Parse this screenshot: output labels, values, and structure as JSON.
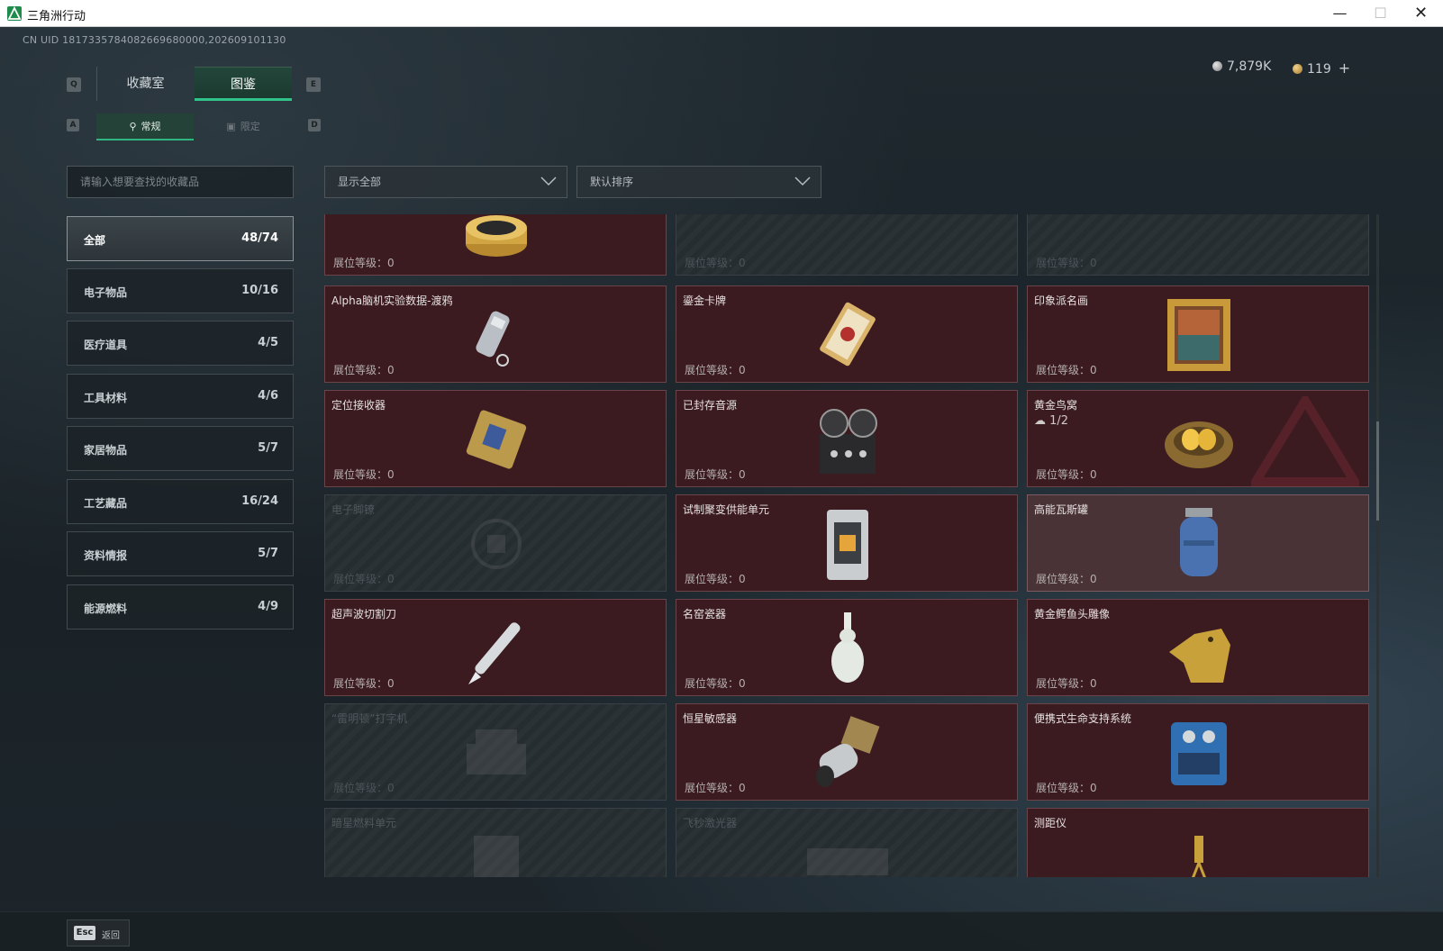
{
  "window": {
    "title": "三角洲行动",
    "controls": {
      "minimize": "—",
      "maximize": "☐",
      "close": "✕"
    }
  },
  "header": {
    "uid": "CN UID 1817335784082669680000,202609101130",
    "currency": [
      {
        "icon": "silver-coin-icon",
        "value": "7,879K"
      },
      {
        "icon": "gold-coin-icon",
        "value": "119",
        "add_label": "+"
      }
    ]
  },
  "tabs": {
    "key_left": "Q",
    "key_right": "E",
    "items": [
      {
        "label": "收藏室",
        "active": false
      },
      {
        "label": "图鉴",
        "active": true
      }
    ]
  },
  "subtabs": {
    "key_left": "A",
    "key_right": "D",
    "items": [
      {
        "icon": "pin-icon",
        "label": "常规",
        "active": true
      },
      {
        "icon": "image-icon",
        "label": "限定",
        "active": false
      }
    ]
  },
  "search": {
    "placeholder": "请输入想要查找的收藏品"
  },
  "filters": [
    {
      "value": "显示全部"
    },
    {
      "value": "默认排序"
    }
  ],
  "categories": [
    {
      "label": "全部",
      "count": "48/74",
      "active": true
    },
    {
      "label": "电子物品",
      "count": "10/16"
    },
    {
      "label": "医疗道具",
      "count": "4/5"
    },
    {
      "label": "工具材料",
      "count": "4/6"
    },
    {
      "label": "家居物品",
      "count": "5/7"
    },
    {
      "label": "工艺藏品",
      "count": "16/24"
    },
    {
      "label": "资料情报",
      "count": "5/7"
    },
    {
      "label": "能源燃料",
      "count": "4/9"
    }
  ],
  "items": [
    {
      "name": "",
      "level": "展位等级：0",
      "state": "owned",
      "icon": "caviar-tin-icon"
    },
    {
      "name": "",
      "level": "展位等级：0",
      "state": "locked",
      "icon": "unknown-item-icon"
    },
    {
      "name": "",
      "level": "展位等级：0",
      "state": "locked",
      "icon": "unknown-item-icon"
    },
    {
      "name": "Alpha脑机实验数据-渡鸦",
      "level": "展位等级：0",
      "state": "owned",
      "icon": "data-drive-icon"
    },
    {
      "name": "鎏金卡牌",
      "level": "展位等级：0",
      "state": "owned",
      "icon": "gilded-card-icon"
    },
    {
      "name": "印象派名画",
      "level": "展位等级：0",
      "state": "owned",
      "icon": "painting-icon"
    },
    {
      "name": "定位接收器",
      "level": "展位等级：0",
      "state": "owned",
      "icon": "receiver-icon"
    },
    {
      "name": "已封存音源",
      "level": "展位等级：0",
      "state": "owned",
      "icon": "reel-recorder-icon"
    },
    {
      "name": "黄金鸟窝",
      "level": "展位等级：0",
      "state": "owned",
      "icon": "golden-nest-icon",
      "extra": "1/2"
    },
    {
      "name": "电子脚镣",
      "level": "展位等级：0",
      "state": "locked",
      "icon": "ankle-monitor-icon"
    },
    {
      "name": "试制聚变供能单元",
      "level": "展位等级：0",
      "state": "owned",
      "icon": "fusion-unit-icon"
    },
    {
      "name": "高能瓦斯罐",
      "level": "展位等级：0",
      "state": "highlight",
      "icon": "gas-tank-icon"
    },
    {
      "name": "超声波切割刀",
      "level": "展位等级：0",
      "state": "owned",
      "icon": "cutter-icon"
    },
    {
      "name": "名窑瓷器",
      "level": "展位等级：0",
      "state": "owned",
      "icon": "porcelain-vase-icon"
    },
    {
      "name": "黄金鳄鱼头雕像",
      "level": "展位等级：0",
      "state": "owned",
      "icon": "croc-statue-icon"
    },
    {
      "name": "“雷明顿”打字机",
      "level": "展位等级：0",
      "state": "locked",
      "icon": "typewriter-icon"
    },
    {
      "name": "恒星敏感器",
      "level": "展位等级：0",
      "state": "owned",
      "icon": "star-sensor-icon"
    },
    {
      "name": "便携式生命支持系统",
      "level": "展位等级：0",
      "state": "owned",
      "icon": "life-support-icon"
    },
    {
      "name": "暗星燃料单元",
      "level": "",
      "state": "locked",
      "icon": "fuel-unit-icon"
    },
    {
      "name": "飞秒激光器",
      "level": "",
      "state": "locked",
      "icon": "laser-icon"
    },
    {
      "name": "测距仪",
      "level": "",
      "state": "owned",
      "icon": "rangefinder-icon"
    }
  ],
  "footer": {
    "esc_key": "Esc",
    "back_label": "返回"
  }
}
